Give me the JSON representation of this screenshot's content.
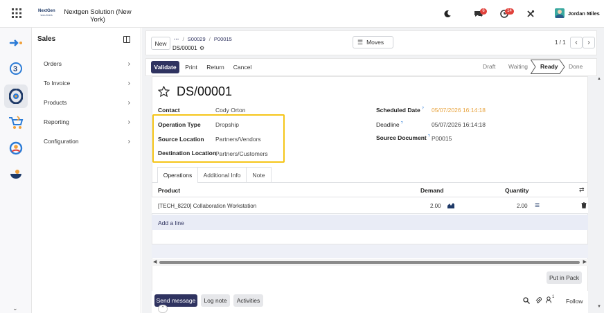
{
  "topbar": {
    "company_logo_text": "NextGen SOLUTIONS",
    "company_name_line1": "Nextgen Solution (New",
    "company_name_line2": "York)",
    "messages_badge": "6",
    "activity_badge": "14",
    "user_name": "Jordan Miles"
  },
  "sidebar": {
    "title": "Sales",
    "items": [
      {
        "label": "Orders"
      },
      {
        "label": "To Invoice"
      },
      {
        "label": "Products"
      },
      {
        "label": "Reporting"
      },
      {
        "label": "Configuration"
      }
    ]
  },
  "control": {
    "new_label": "New",
    "breadcrumb_ellipsis": "···",
    "breadcrumb_1": "S00029",
    "breadcrumb_2": "P00015",
    "record_ref": "DS/00001",
    "moves_label": "Moves",
    "pager": "1 / 1"
  },
  "actions": {
    "validate": "Validate",
    "print": "Print",
    "return": "Return",
    "cancel": "Cancel"
  },
  "statusbar": [
    "Draft",
    "Waiting",
    "Ready",
    "Done"
  ],
  "record": {
    "title": "DS/00001",
    "contact_label": "Contact",
    "contact_value": "Cody Orton",
    "operation_type_label": "Operation Type",
    "operation_type_value": "Dropship",
    "source_location_label": "Source Location",
    "source_location_value": "Partners/Vendors",
    "destination_location_label": "Destination Location",
    "destination_location_value": "Partners/Customers",
    "scheduled_date_label": "Scheduled Date",
    "scheduled_date_value": "05/07/2026 16:14:18",
    "deadline_label": "Deadline",
    "deadline_value": "05/07/2026 16:14:18",
    "source_document_label": "Source Document",
    "source_document_value": "P00015",
    "help_mark": "?"
  },
  "tabs": [
    "Operations",
    "Additional Info",
    "Note"
  ],
  "table": {
    "headers": {
      "product": "Product",
      "demand": "Demand",
      "quantity": "Quantity"
    },
    "rows": [
      {
        "product": "[TECH_8220] Collaboration Workstation",
        "demand": "2.00",
        "quantity": "2.00"
      }
    ],
    "add_line": "Add a line"
  },
  "put_in_pack": "Put in Pack",
  "chatter": {
    "send_message": "Send message",
    "log_note": "Log note",
    "activities": "Activities",
    "followers_count": "1",
    "follow": "Follow"
  },
  "colors": {
    "primary": "#2f3360",
    "highlight_box": "#f5c518",
    "date_warning": "#e8a33d"
  }
}
